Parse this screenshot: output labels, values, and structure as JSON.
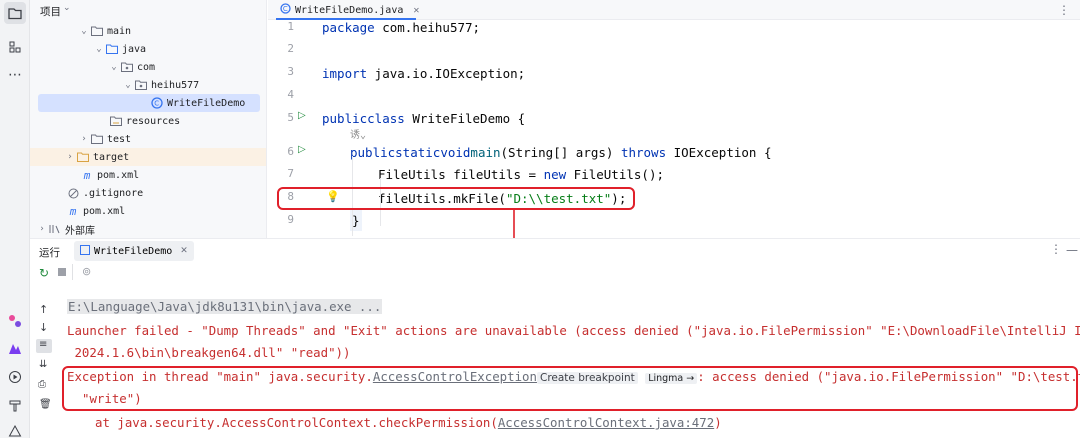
{
  "project": {
    "header_label": "项目",
    "tree": [
      {
        "label": "main",
        "kind": "folder"
      },
      {
        "label": "java",
        "kind": "folder-src"
      },
      {
        "label": "com",
        "kind": "package"
      },
      {
        "label": "heihu577",
        "kind": "package"
      },
      {
        "label": "WriteFileDemo",
        "kind": "class",
        "selected": true
      },
      {
        "label": "resources",
        "kind": "folder-res"
      },
      {
        "label": "test",
        "kind": "folder"
      },
      {
        "label": "target",
        "kind": "folder-excluded"
      },
      {
        "label": "pom.xml",
        "kind": "maven"
      },
      {
        "label": ".gitignore",
        "kind": "ignore"
      },
      {
        "label": "pom.xml",
        "kind": "maven"
      },
      {
        "label": "外部库",
        "kind": "library"
      }
    ]
  },
  "editor": {
    "tab_label": "WriteFileDemo.java",
    "line_numbers": [
      "1",
      "2",
      "3",
      "4",
      "5",
      "6",
      "7",
      "8",
      "9"
    ],
    "code": {
      "l1_kw": "package",
      "l1_rest": " com.heihu577;",
      "l3_kw": "import",
      "l3_rest": " java.io.IOException;",
      "l5_kw1": "public",
      "l5_kw2": "class",
      "l5_rest": " WriteFileDemo {",
      "l6_hint": "诱⌄",
      "l7_kw1": "public",
      "l7_kw2": "static",
      "l7_kw3": "void",
      "l7_fn": "main",
      "l7_mid": "(String[] args) ",
      "l7_kw4": "throws",
      "l7_rest": " IOException {",
      "l8_a": "FileUtils fileUtils = ",
      "l8_kw": "new",
      "l8_b": " FileUtils();",
      "l9_a": "fileUtils.mkFile(",
      "l9_str": "\"D:\\\\test.txt\"",
      "l9_b": ");",
      "l10": "}"
    }
  },
  "run": {
    "tab_title": "运行",
    "config_label": "WriteFileDemo",
    "lines": {
      "cmd": "E:\\Language\\Java\\jdk8u131\\bin\\java.exe ...",
      "launcher1": "Launcher failed - \"Dump Threads\" and \"Exit\" actions are unavailable (access denied (\"java.io.FilePermission\" \"E:\\DownloadFile\\IntelliJ IDEA",
      "launcher2": " 2024.1.6\\bin\\breakgen64.dll\" \"read\"))",
      "exc_prefix": "Exception in thread \"main\" java.security.",
      "exc_link": "AccessControlException",
      "exc_tag": "Create breakpoint",
      "exc_lingma": "Lingma →",
      "exc_suffix": ": access denied (\"java.io.FilePermission\" \"D:\\test.txt\"",
      "exc_line2": "\"write\")",
      "at_prefix": "at java.security.AccessControlContext.checkPermission(",
      "at_link": "AccessControlContext.java:472",
      "at_suffix": ")"
    }
  },
  "colors": {
    "annotation_red": "#e0202a",
    "accent_blue": "#3574f0",
    "error_text": "#c62f2f"
  }
}
